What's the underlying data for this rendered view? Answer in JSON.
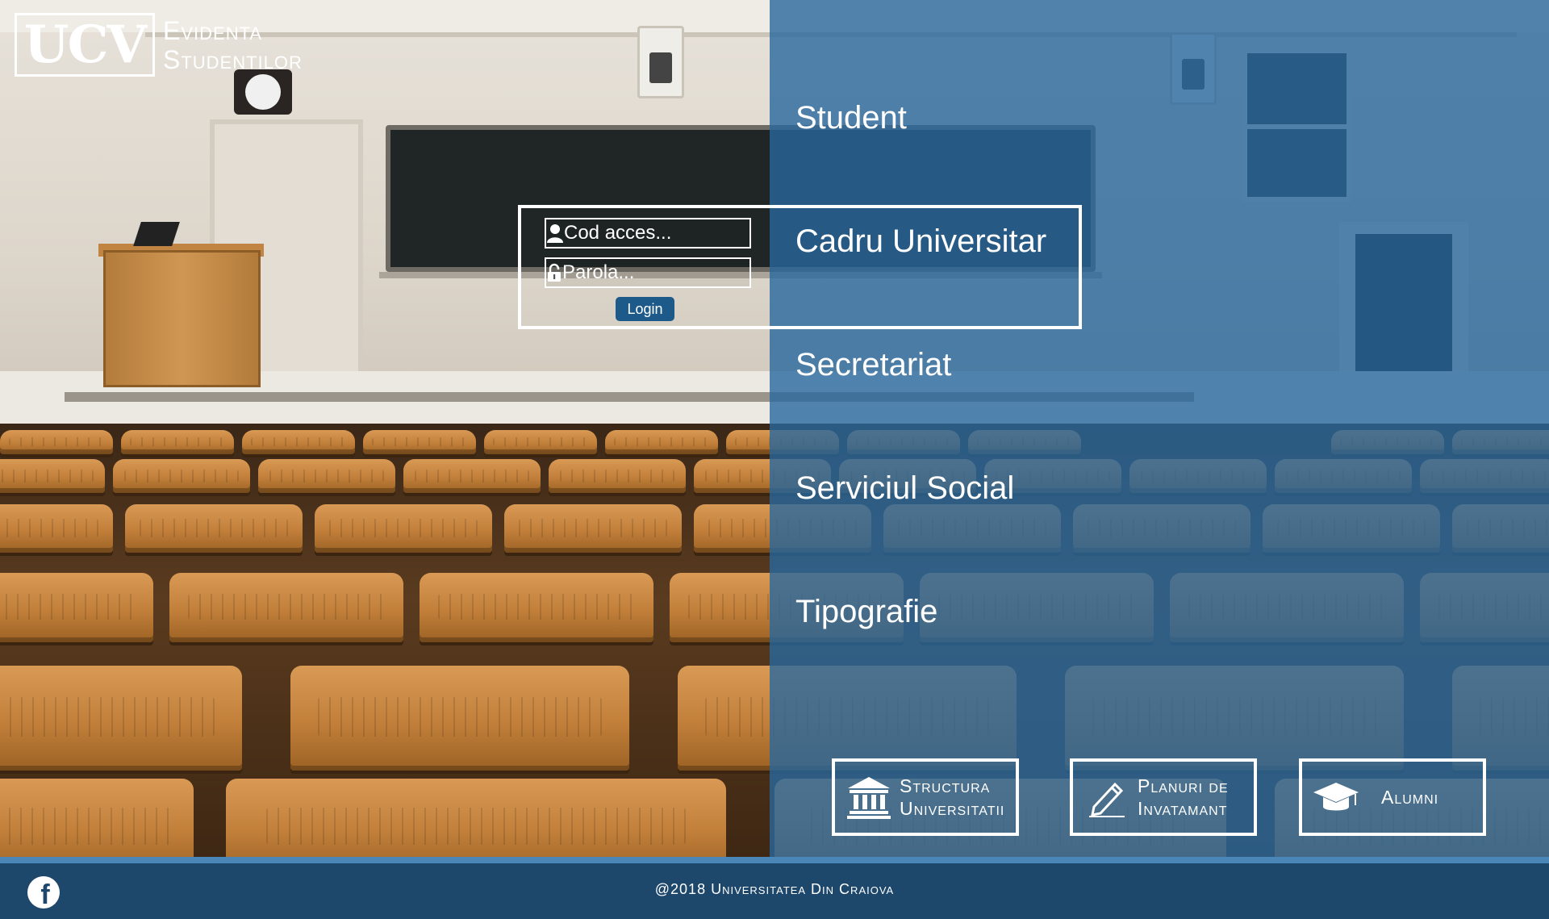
{
  "brand": {
    "mark": "UCV",
    "title_line1": "Evidenta",
    "title_line2": "Studentilor"
  },
  "nav": {
    "items": [
      {
        "label": "Student"
      },
      {
        "label": "Cadru Universitar"
      },
      {
        "label": "Secretariat"
      },
      {
        "label": "Serviciul Social"
      },
      {
        "label": "Tipografie"
      }
    ]
  },
  "login": {
    "access_code_placeholder": "Cod acces...",
    "access_code_value": "",
    "password_placeholder": "Parola...",
    "password_value": "",
    "button_label": "Login",
    "user_icon": "user-icon",
    "lock_icon": "lock-icon"
  },
  "tiles": [
    {
      "label_line1": "Structura",
      "label_line2": "Universitatii",
      "icon": "university-building-icon"
    },
    {
      "label_line1": "Planuri de",
      "label_line2": "Invatamant",
      "icon": "pencil-icon"
    },
    {
      "label_line1": "Alumni",
      "label_line2": "",
      "icon": "graduation-cap-icon"
    }
  ],
  "footer": {
    "copyright": "@2018 Universitatea Din Craiova",
    "social_icon": "facebook-icon",
    "social_letter": "f"
  },
  "colors": {
    "overlay_blue": "#28689e",
    "footer_blue": "#1d476b",
    "button_blue": "#1d5a8a",
    "text": "#ffffff"
  }
}
